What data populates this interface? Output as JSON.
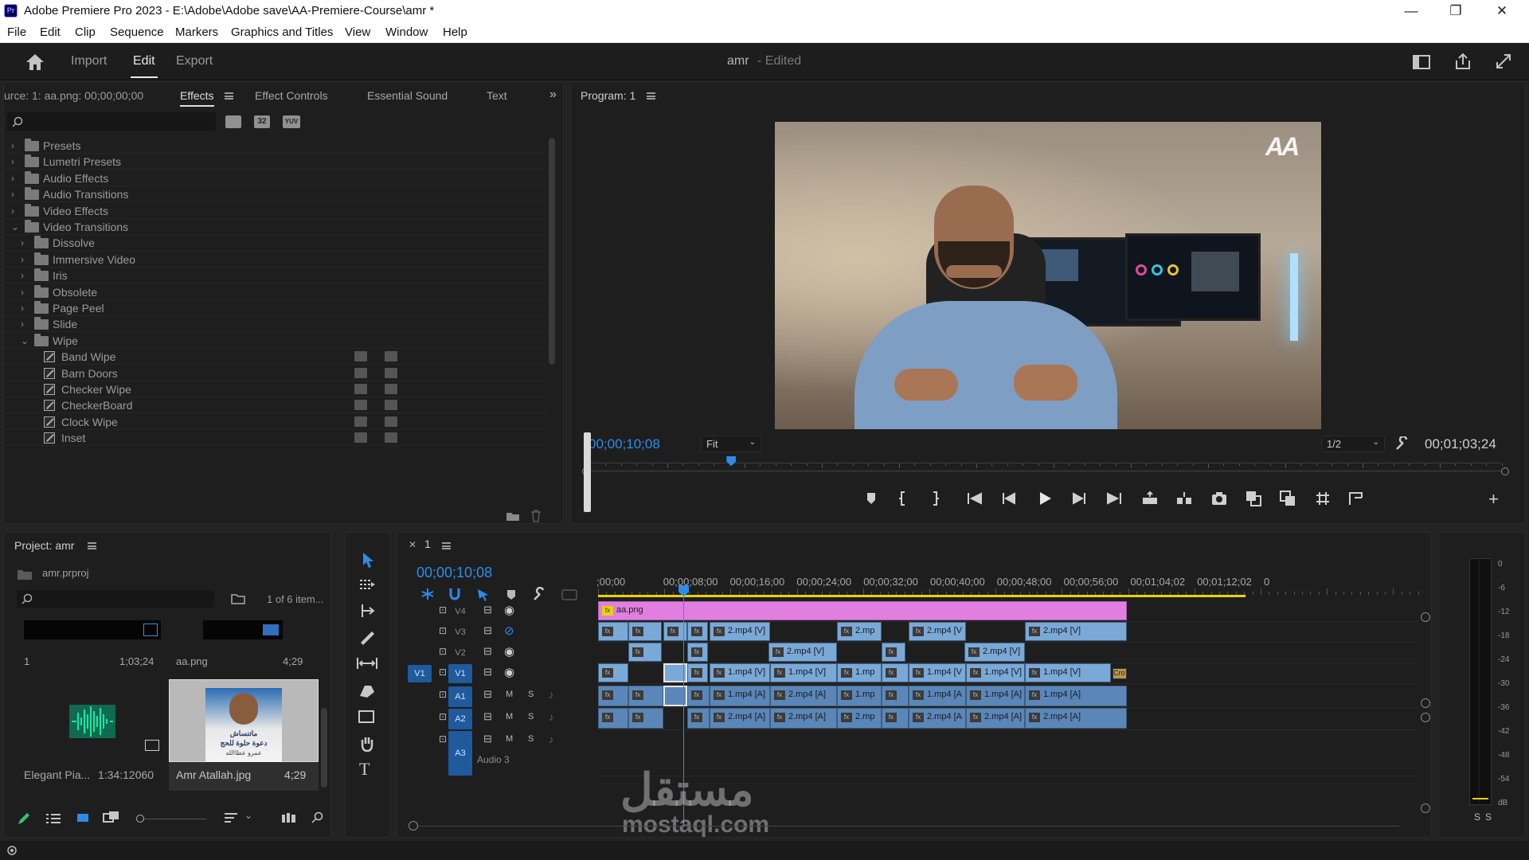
{
  "titlebar": {
    "app_icon": "Pr",
    "title": "Adobe Premiere Pro 2023 - E:\\Adobe\\Adobe save\\AA-Premiere-Course\\amr *",
    "minimize": "—",
    "restore": "❐",
    "close": "✕"
  },
  "menu": [
    "File",
    "Edit",
    "Clip",
    "Sequence",
    "Markers",
    "Graphics and Titles",
    "View",
    "Window",
    "Help"
  ],
  "header": {
    "home_icon": "home-icon",
    "tabs": [
      "Import",
      "Edit",
      "Export"
    ],
    "active_tab": "Edit",
    "project_name": "amr",
    "project_status": "- Edited"
  },
  "effects_panel": {
    "source_label": "urce: 1: aa.png: 00;00;00;00",
    "tabs": [
      "Effects",
      "Effect Controls",
      "Essential Sound",
      "Text"
    ],
    "active_tab": "Effects",
    "icon_badges": [
      "32",
      "YUV"
    ],
    "tree": [
      {
        "label": "Presets",
        "level": 0,
        "open": false,
        "kind": "preset-folder"
      },
      {
        "label": "Lumetri Presets",
        "level": 0,
        "open": false,
        "kind": "preset-folder"
      },
      {
        "label": "Audio Effects",
        "level": 0,
        "open": false,
        "kind": "folder"
      },
      {
        "label": "Audio Transitions",
        "level": 0,
        "open": false,
        "kind": "folder"
      },
      {
        "label": "Video Effects",
        "level": 0,
        "open": false,
        "kind": "folder"
      },
      {
        "label": "Video Transitions",
        "level": 0,
        "open": true,
        "kind": "folder"
      },
      {
        "label": "Dissolve",
        "level": 1,
        "open": false,
        "kind": "folder"
      },
      {
        "label": "Immersive Video",
        "level": 1,
        "open": false,
        "kind": "folder"
      },
      {
        "label": "Iris",
        "level": 1,
        "open": false,
        "kind": "folder"
      },
      {
        "label": "Obsolete",
        "level": 1,
        "open": false,
        "kind": "folder"
      },
      {
        "label": "Page Peel",
        "level": 1,
        "open": false,
        "kind": "folder"
      },
      {
        "label": "Slide",
        "level": 1,
        "open": false,
        "kind": "folder"
      },
      {
        "label": "Wipe",
        "level": 1,
        "open": true,
        "kind": "folder"
      },
      {
        "label": "Band Wipe",
        "level": 2,
        "kind": "effect"
      },
      {
        "label": "Barn Doors",
        "level": 2,
        "kind": "effect"
      },
      {
        "label": "Checker Wipe",
        "level": 2,
        "kind": "effect"
      },
      {
        "label": "CheckerBoard",
        "level": 2,
        "kind": "effect"
      },
      {
        "label": "Clock Wipe",
        "level": 2,
        "kind": "effect"
      },
      {
        "label": "Inset",
        "level": 2,
        "kind": "effect"
      }
    ]
  },
  "program_monitor": {
    "title": "Program: 1",
    "current_timecode": "00;00;10;08",
    "fit": "Fit",
    "resolution": "1/2",
    "duration": "00;01;03;24",
    "watermark": "AA",
    "playhead_fraction": 0.155
  },
  "project_panel": {
    "title": "Project: amr",
    "file": "amr.prproj",
    "item_count": "1 of 6 item...",
    "items": [
      {
        "name": "1",
        "duration": "1;03;24"
      },
      {
        "name": "aa.png",
        "duration": "4;29"
      },
      {
        "name": "Elegant Pia...",
        "duration": "1:34:12060"
      },
      {
        "name": "Amr Atallah.jpg",
        "duration": "4;29"
      }
    ],
    "thumb_text_1": "ماتنساش",
    "thumb_text_2": "دعوة حلوة للحج",
    "thumb_text_3": "عمرو عطاالله"
  },
  "timeline": {
    "sequence_name": "1",
    "timecode": "00;00;10;08",
    "ruler": [
      ";00;00",
      "00;00;08;00",
      "00;00;16;00",
      "00;00;24;00",
      "00;00;32;00",
      "00;00;40;00",
      "00;00;48;00",
      "00;00;56;00",
      "00;01;04;02",
      "00;01;12;02",
      "0"
    ],
    "video_tracks": [
      "V4",
      "V3",
      "V2",
      "V1"
    ],
    "audio_tracks": [
      "A1",
      "A2",
      "A3"
    ],
    "source_patch": "V1",
    "audio3_name": "Audio 3",
    "track_buttons": {
      "mute": "M",
      "solo": "S"
    },
    "v4_clip": "aa.png",
    "v3_clips": [
      "2.mp4 [V]",
      "2.mp",
      "2.mp4 [V",
      "2.mp4 [V]"
    ],
    "v2_clips": [
      "2.mp4 [V]",
      "2.mp4 [V]"
    ],
    "v1_clips": [
      "1.mp4 [V]",
      "1.mp4 [V]",
      "1.mp",
      "1.mp4 [V",
      "1.mp4 [V]",
      "1.mp4 [V]",
      "Cro"
    ],
    "a1_clips": [
      "1.mp4 [A]",
      "2.mp4 [A]",
      "1.mp",
      "1.mp4 [A",
      "1.mp4 [A]",
      "1.mp4 [A]"
    ],
    "a2_clips": [
      "2.mp4 [A]",
      "2.mp4 [A]",
      "2.mp",
      "2.mp4 [A",
      "2.mp4 [A]",
      "2.mp4 [A]"
    ]
  },
  "audio_meter": {
    "scale": [
      "0",
      "-6",
      "-12",
      "-18",
      "-24",
      "-30",
      "-36",
      "-42",
      "-48",
      "-54",
      "dB"
    ],
    "solo": [
      "S",
      "S"
    ]
  },
  "watermark": {
    "arabic": "مستقل",
    "latin": "mostaql.com"
  },
  "colors": {
    "accent": "#2d8ceb",
    "clip_video": "#7aa9d8",
    "clip_graphic": "#e07fdf",
    "work_area": "#e6d300"
  }
}
